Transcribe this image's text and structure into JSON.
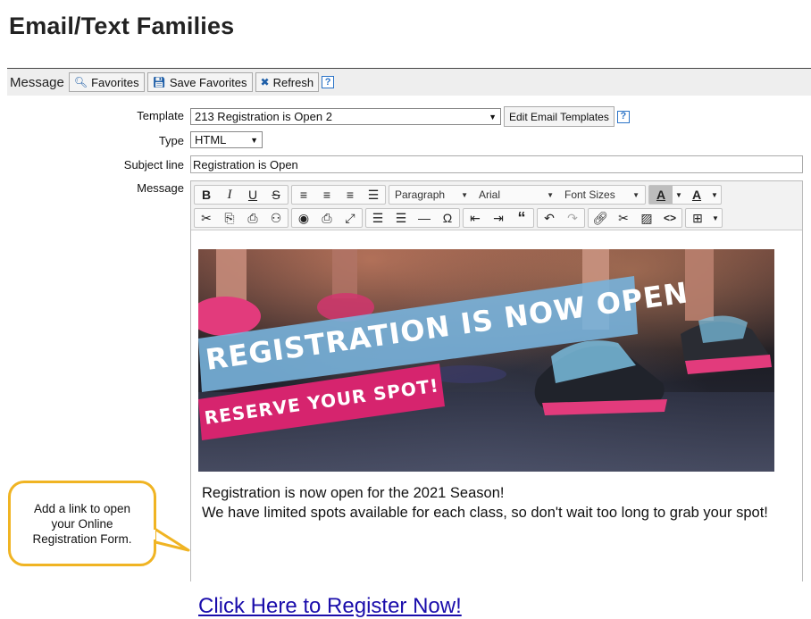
{
  "page": {
    "title": "Email/Text Families"
  },
  "toolbar": {
    "label": "Message",
    "favorites_label": "Favorites",
    "save_favorites_label": "Save Favorites",
    "refresh_label": "Refresh",
    "help": "?"
  },
  "form": {
    "template_label": "Template",
    "template_value": "213 Registration is Open 2",
    "edit_templates_label": "Edit Email Templates",
    "help": "?",
    "type_label": "Type",
    "type_value": "HTML",
    "subject_label": "Subject line",
    "subject_value": "Registration is Open",
    "message_label": "Message"
  },
  "editor": {
    "format_dropdown": "Paragraph",
    "font_dropdown": "Arial",
    "size_dropdown": "Font Sizes",
    "text_color_label": "A",
    "bg_color_label": "A"
  },
  "banner": {
    "headline": "REGISTRATION IS NOW OPEN",
    "subline": "RESERVE YOUR SPOT!"
  },
  "message": {
    "line1": "Registration is now open for the 2021 Season!",
    "line2": "We have limited spots available for each class, so don't wait too long to grab your spot!",
    "link_text": "Click Here to Register Now!"
  },
  "callout": {
    "line1": "Add a link to open",
    "line2": "your Online",
    "line3": "Registration Form."
  },
  "colors": {
    "accent_link": "#1a0dab",
    "callout_border": "#f0b423",
    "help_icon": "#2a73c7",
    "banner_pink": "#d6246e"
  }
}
